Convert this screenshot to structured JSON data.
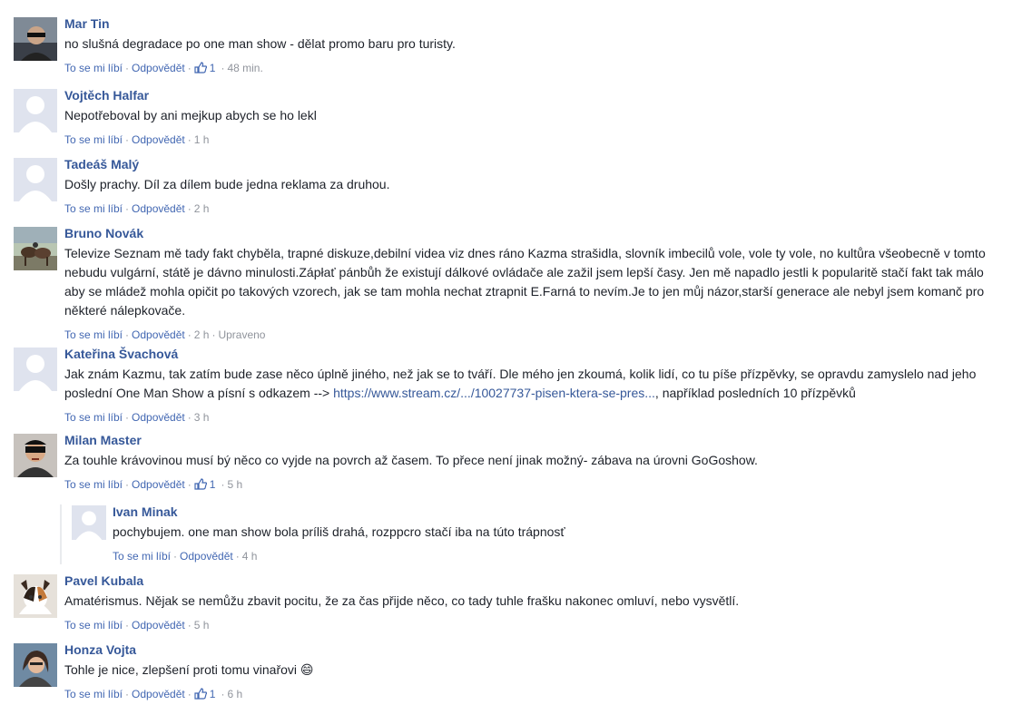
{
  "actions": {
    "like": "To se mi líbí",
    "reply": "Odpovědět",
    "separator": "·"
  },
  "comments": [
    {
      "author": "Mar Tin",
      "text": "no slušná degradace po one man show - dělat promo baru pro turisty.",
      "likes": "1",
      "time": "48 min.",
      "avatar": "photo-dark"
    },
    {
      "author": "Vojtěch Halfar",
      "text": "Nepotřeboval by ani mejkup abych se ho lekl",
      "likes": "",
      "time": "1 h",
      "avatar": "default"
    },
    {
      "author": "Tadeáš Malý",
      "text": "Došly prachy. Díl za dílem bude jedna reklama za druhou.",
      "likes": "",
      "time": "2 h",
      "avatar": "default"
    },
    {
      "author": "Bruno Novák",
      "text": "Televize Seznam mě tady fakt chyběla, trapné diskuze,debilní videa viz dnes ráno Kazma strašidla, slovník imbecilů vole, vole ty vole, no kultůra všeobecně v tomto nebudu vulgární, státě je dávno minulosti.Zápłať pánbůh že existují dálkové ovládače ale zažil jsem lepší časy. Jen mě napadlo jestli k popularitě stačí fakt tak málo aby se mládež mohla opičit po takových vzorech, jak se tam mohla nechat ztrapnit E.Farná to nevím.Je to jen můj názor,starší generace ale nebyl jsem komanč pro některé nálepkovače.",
      "likes": "",
      "time": "2 h",
      "edited": "Upraveno",
      "avatar": "photo-horses"
    },
    {
      "author": "Kateřina Švachová",
      "text": "Jak znám Kazmu, tak zatím bude zase něco úplně jiného, než jak se to tváří. Dle mého jen zkoumá, kolik lidí, co tu píše přízpěvky, se opravdu zamyslelo nad jeho poslední One Man Show a písní s odkazem -->",
      "link": "https://www.stream.cz/.../10027737-pisen-ktera-se-pres...",
      "text_after": ", například posledních 10 přízpěvků",
      "likes": "",
      "time": "3 h",
      "avatar": "default"
    },
    {
      "author": "Milan Master",
      "text": "Za touhle krávovinou musí bý něco co vyjde na povrch až časem. To přece není jinak možný- zábava na úrovni GoGoshow.",
      "likes": "1",
      "time": "5 h",
      "avatar": "photo-mask"
    },
    {
      "author": "Ivan Minak",
      "text": "pochybujem. one man show bola príliš drahá, rozppcro stačí iba na túto trápnosť",
      "likes": "",
      "time": "4 h",
      "avatar": "default",
      "is_reply": true
    },
    {
      "author": "Pavel Kubala",
      "text": "Amatérismus. Nějak se nemůžu zbavit pocitu, že za čas přijde něco, co tady tuhle frašku nakonec omluví, nebo vysvětlí.",
      "likes": "",
      "time": "5 h",
      "avatar": "photo-cat"
    },
    {
      "author": "Honza Vojta",
      "text": "Tohle je nice, zlepšení proti tomu vinařovi",
      "emoji": "😄",
      "likes": "1",
      "time": "6 h",
      "avatar": "photo-girl"
    }
  ],
  "colors": {
    "author": "#365899",
    "link": "#4267b2",
    "meta": "#90949c",
    "text": "#1d2129"
  }
}
